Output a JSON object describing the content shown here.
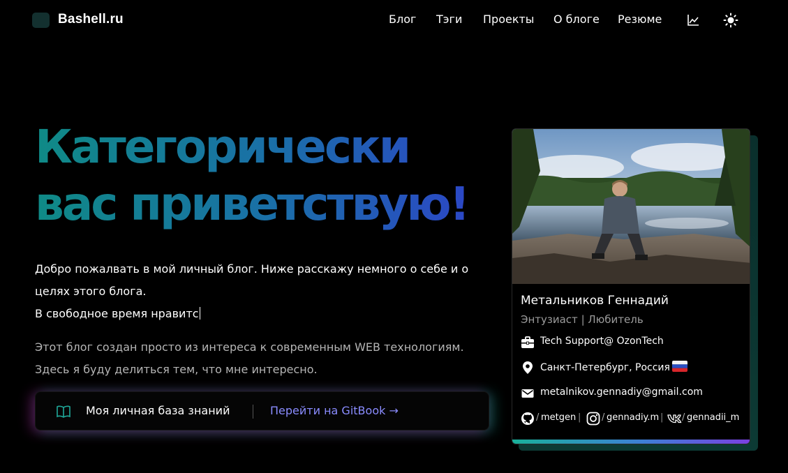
{
  "header": {
    "site_name": "Bashell.ru",
    "nav": [
      "Блог",
      "Тэги",
      "Проекты",
      "О блоге",
      "Резюме"
    ],
    "icons": [
      "chart-icon",
      "sun-icon"
    ]
  },
  "hero": {
    "title_line1": "Категорически",
    "title_line2": "вас приветствую!",
    "intro_line1": "Добро пожалвать в мой личный блог. Ниже расскажу немного о себе и о",
    "intro_line2": "целях этого блога.",
    "typing_text": "В свободное время нравитс",
    "about_line1": "Этот блог создан просто из интереса к современным WEB технологиям.",
    "about_line2": "Здесь я буду делиться тем, что мне интересно."
  },
  "knowledge_base": {
    "label": "Моя личная база знаний",
    "link": "Перейти на GitBook →"
  },
  "card": {
    "name": "Метальников Геннадий",
    "role": "Энтузиаст | Любитель",
    "job": "Tech Support@ OzonTech",
    "location": "Санкт-Петербург, Россия",
    "email": "metalnikov.gennadiy@gmail.com",
    "socials": [
      {
        "icon": "github-icon",
        "prefix": "/",
        "handle": "metgen"
      },
      {
        "icon": "instagram-icon",
        "prefix": "/",
        "handle": "gennadiy.m"
      },
      {
        "icon": "vk-icon",
        "prefix": "/",
        "handle": "gennadii_m"
      }
    ],
    "separator": "|"
  },
  "colors": {
    "background": "#000000",
    "title_gradient": [
      "#0f8a86",
      "#1a6fa8",
      "#2f3fcc"
    ],
    "link": "#8a8cff",
    "muted_text": "#b5b5b5"
  }
}
